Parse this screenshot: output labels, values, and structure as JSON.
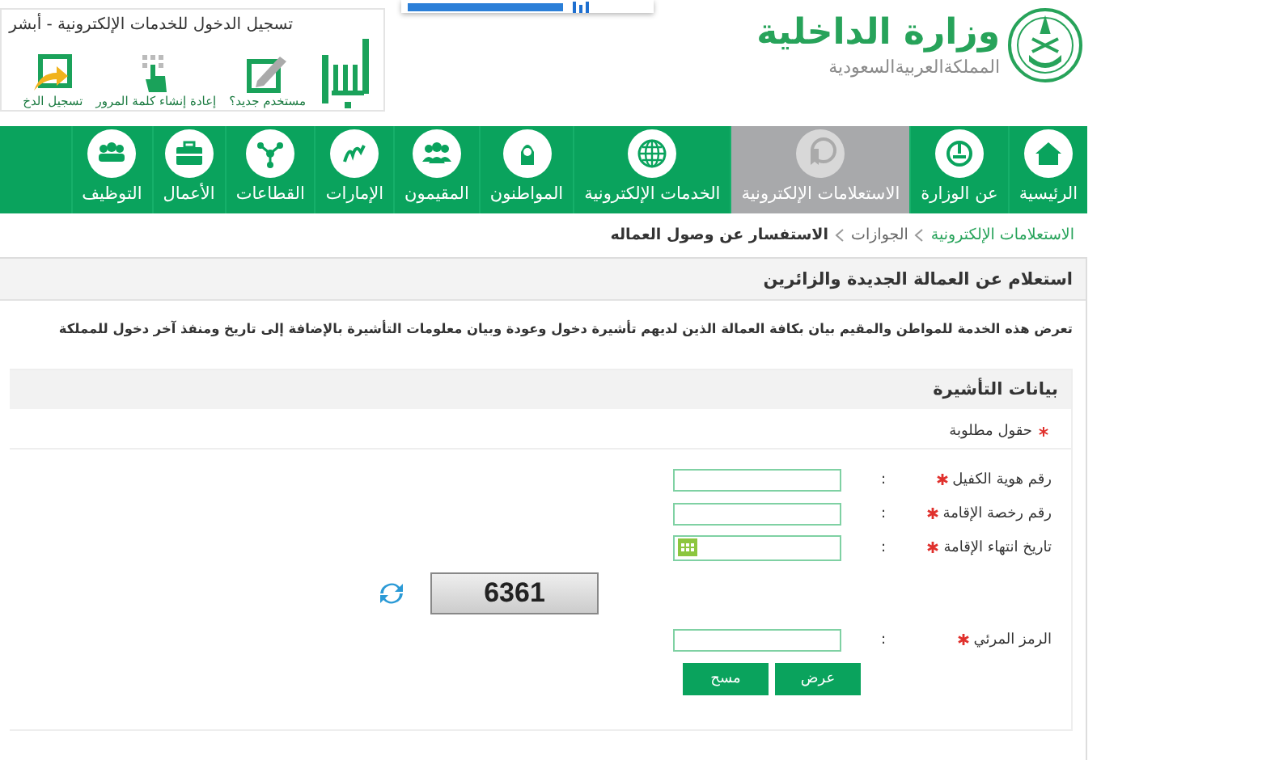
{
  "header": {
    "title": "وزارة الداخلية",
    "subtitle": "المملكةالعربيةالسعودية",
    "login_box": {
      "title": "تسجيل الدخول للخدمات الإلكترونية - أبشر",
      "links": [
        {
          "label": "مستخدم جديد؟",
          "kind": "new-user"
        },
        {
          "label": "إعادة إنشاء كلمة المرور",
          "kind": "reset"
        },
        {
          "label": "تسجيل الدخ",
          "kind": "login"
        }
      ]
    }
  },
  "nav": [
    {
      "label": "الرئيسية",
      "selected": false
    },
    {
      "label": "عن الوزارة",
      "selected": false
    },
    {
      "label": "الاستعلامات الإلكترونية",
      "selected": true
    },
    {
      "label": "الخدمات الإلكترونية",
      "selected": false
    },
    {
      "label": "المواطنون",
      "selected": false
    },
    {
      "label": "المقيمون",
      "selected": false
    },
    {
      "label": "الإمارات",
      "selected": false
    },
    {
      "label": "القطاعات",
      "selected": false
    },
    {
      "label": "الأعمال",
      "selected": false
    },
    {
      "label": "التوظيف",
      "selected": false
    }
  ],
  "breadcrumb": [
    {
      "label": "الاستعلامات الإلكترونية",
      "kind": "link"
    },
    {
      "label": "الجوازات",
      "kind": "plain"
    },
    {
      "label": "الاستفسار عن وصول العماله",
      "kind": "current"
    }
  ],
  "panel": {
    "title": "استعلام عن العمالة الجديدة والزائرين",
    "description": "تعرض هذه الخدمة للمواطن والمقيم بيان بكافة العمالة الذين لديهم تأشيرة دخول وعودة وبيان معلومات التأشيرة بالإضافة إلى تاريخ ومنفذ آخر دخول للمملكة",
    "section": {
      "title": "بيانات التأشيرة",
      "required_note": "حقول مطلوبة",
      "fields": [
        {
          "kind": "text",
          "label": "رقم هوية الكفيل",
          "required": true,
          "separator": ":"
        },
        {
          "kind": "text",
          "label": "رقم رخصة الإقامة",
          "required": true,
          "separator": ":"
        },
        {
          "kind": "date",
          "label": "تاريخ انتهاء الإقامة",
          "required": true,
          "separator": ":"
        },
        {
          "kind": "captcha",
          "code": "6361"
        },
        {
          "kind": "text",
          "label": "الرمز المرئي",
          "required": true,
          "separator": ":"
        }
      ],
      "buttons": [
        "عرض",
        "مسح"
      ]
    }
  }
}
